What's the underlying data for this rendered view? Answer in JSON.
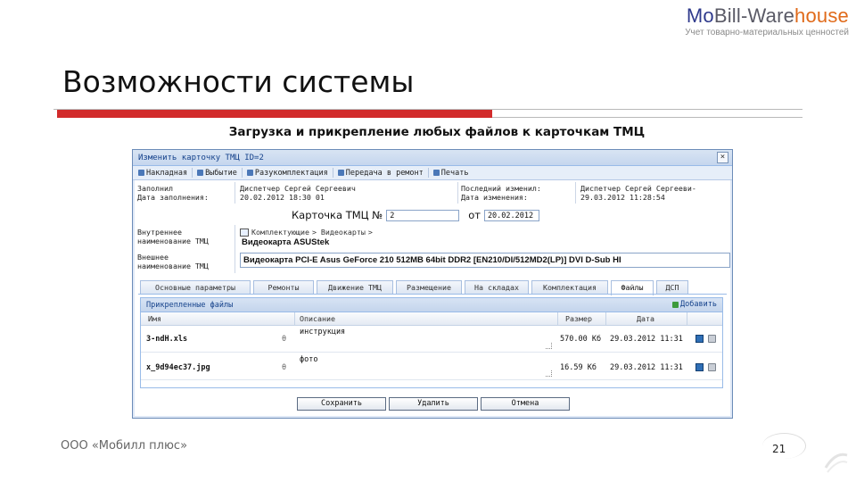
{
  "logo": {
    "prefix": "Mo",
    "mid": "Bill-Ware",
    "suffix": "house",
    "tagline": "Учет товарно-материальных ценностей"
  },
  "slide": {
    "title": "Возможности системы",
    "subtitle": "Загрузка и прикрепление любых файлов к карточкам ТМЦ",
    "footer": "ООО «Мобилл плюс»",
    "page_number": "21"
  },
  "colors": {
    "accent_red": "#d22b2b",
    "window_border": "#6c8cb8",
    "header_blue": "#15428b"
  },
  "window": {
    "title": "Изменить карточку ТМЦ ID=2",
    "toolbar": [
      {
        "label": "Накладная",
        "icon": "document-icon"
      },
      {
        "label": "Выбытие",
        "icon": "remove-icon"
      },
      {
        "label": "Разукомплектация",
        "icon": "split-icon"
      },
      {
        "label": "Передача в ремонт",
        "icon": "repair-icon"
      },
      {
        "label": "Печать",
        "icon": "print-icon"
      }
    ],
    "meta": {
      "filled_label": "Заполнил",
      "fill_date_label": "Дата заполнения:",
      "filled_by": "Диспетчер Сергей Сергеевич",
      "fill_date": "20.02.2012 18:30 01",
      "last_changed_label": "Последний изменил:",
      "change_date_label": "Дата изменения:",
      "changed_by": "Диспетчер Сергей Сергееви-",
      "change_date": "29.03.2012 11:28:54"
    },
    "card": {
      "label": "Карточка ТМЦ №",
      "number": "2",
      "date_prefix": "от",
      "date": "20.02.2012"
    },
    "internal_name_label_1": "Внутреннее",
    "internal_name_label_2": "наименование ТМЦ",
    "breadcrumb": [
      "Комплектующие",
      "> Видеокарты",
      ">"
    ],
    "internal_name": "Видеокарта ASUStek",
    "external_name_label_1": "Внешнее",
    "external_name_label_2": "наименование ТМЦ",
    "external_name": "Видеокарта PCI-E Asus GeForce 210 512MB 64bit DDR2 [EN210/DI/512MD2(LP)] DVI D-Sub HI",
    "tabs": [
      "Основные параметры",
      "Ремонты",
      "Движение ТМЦ",
      "Размещение",
      "На складах",
      "Комплектация",
      "Файлы",
      "ДСП"
    ],
    "active_tab": "Файлы",
    "files_panel": {
      "title": "Прикрепленные файлы",
      "add_label": "Добавить",
      "columns": [
        "Имя",
        "Описание",
        "Размер",
        "Дата"
      ],
      "rows": [
        {
          "name": "3-ndH.xls",
          "description": "инструкция",
          "size": "570.00 Кб",
          "date": "29.03.2012 11:31"
        },
        {
          "name": "x_9d94ec37.jpg",
          "description": "фото",
          "size": "16.59 Кб",
          "date": "29.03.2012 11:31"
        }
      ]
    },
    "buttons": {
      "save": "Сохранить",
      "delete": "Удалить",
      "cancel": "Отмена"
    }
  }
}
